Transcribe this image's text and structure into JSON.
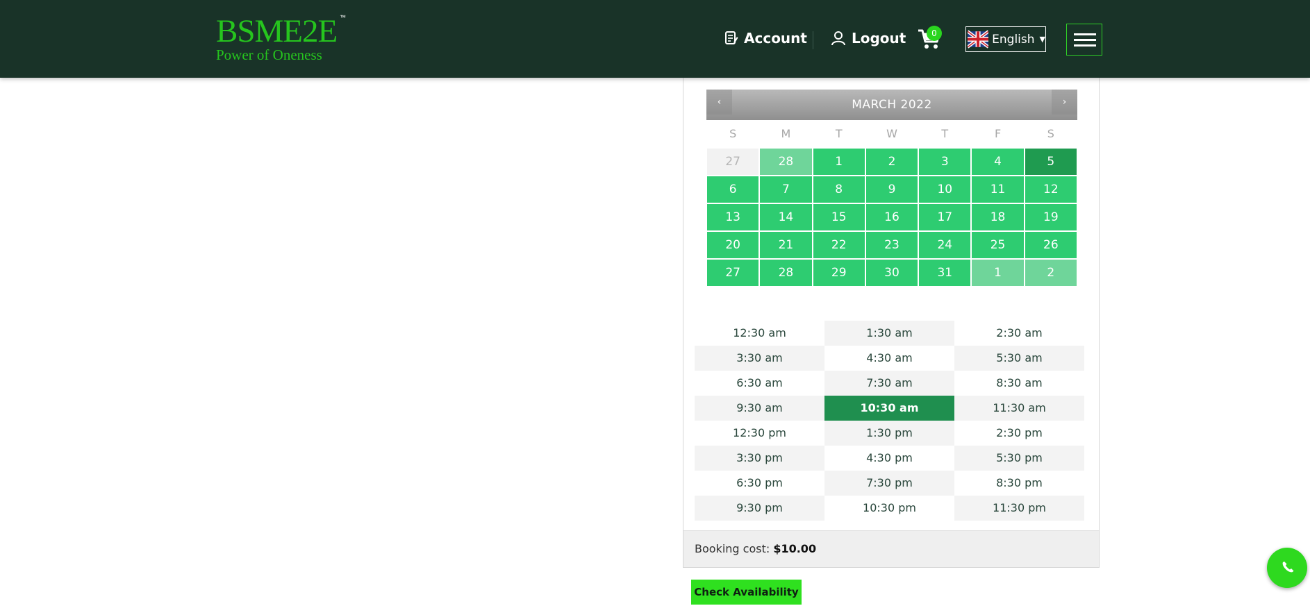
{
  "header": {
    "logo_text": "BSME2E",
    "logo_tm": "™",
    "logo_tagline": "Power of Oneness",
    "account_label": "Account",
    "logout_label": "Logout",
    "cart_count": "0",
    "language": "English",
    "icons": [
      "account-icon",
      "user-icon",
      "cart-icon",
      "uk-flag-icon",
      "menu-icon",
      "phone-icon"
    ]
  },
  "calendar": {
    "title": "MARCH 2022",
    "prev_label": "‹",
    "next_label": "›",
    "weekdays": [
      "S",
      "M",
      "T",
      "W",
      "T",
      "F",
      "S"
    ],
    "weeks": [
      [
        {
          "d": "27",
          "s": "other"
        },
        {
          "d": "28",
          "s": "light"
        },
        {
          "d": "1",
          "s": ""
        },
        {
          "d": "2",
          "s": ""
        },
        {
          "d": "3",
          "s": ""
        },
        {
          "d": "4",
          "s": ""
        },
        {
          "d": "5",
          "s": "today"
        }
      ],
      [
        {
          "d": "6",
          "s": ""
        },
        {
          "d": "7",
          "s": ""
        },
        {
          "d": "8",
          "s": ""
        },
        {
          "d": "9",
          "s": ""
        },
        {
          "d": "10",
          "s": ""
        },
        {
          "d": "11",
          "s": ""
        },
        {
          "d": "12",
          "s": ""
        }
      ],
      [
        {
          "d": "13",
          "s": ""
        },
        {
          "d": "14",
          "s": ""
        },
        {
          "d": "15",
          "s": ""
        },
        {
          "d": "16",
          "s": ""
        },
        {
          "d": "17",
          "s": ""
        },
        {
          "d": "18",
          "s": ""
        },
        {
          "d": "19",
          "s": ""
        }
      ],
      [
        {
          "d": "20",
          "s": ""
        },
        {
          "d": "21",
          "s": ""
        },
        {
          "d": "22",
          "s": ""
        },
        {
          "d": "23",
          "s": ""
        },
        {
          "d": "24",
          "s": ""
        },
        {
          "d": "25",
          "s": ""
        },
        {
          "d": "26",
          "s": ""
        }
      ],
      [
        {
          "d": "27",
          "s": ""
        },
        {
          "d": "28",
          "s": ""
        },
        {
          "d": "29",
          "s": ""
        },
        {
          "d": "30",
          "s": ""
        },
        {
          "d": "31",
          "s": ""
        },
        {
          "d": "1",
          "s": "light"
        },
        {
          "d": "2",
          "s": "light"
        }
      ]
    ]
  },
  "time_slots": [
    "12:30 am",
    "1:30 am",
    "2:30 am",
    "3:30 am",
    "4:30 am",
    "5:30 am",
    "6:30 am",
    "7:30 am",
    "8:30 am",
    "9:30 am",
    "10:30 am",
    "11:30 am",
    "12:30 pm",
    "1:30 pm",
    "2:30 pm",
    "3:30 pm",
    "4:30 pm",
    "5:30 pm",
    "6:30 pm",
    "7:30 pm",
    "8:30 pm",
    "9:30 pm",
    "10:30 pm",
    "11:30 pm"
  ],
  "selected_slot": "10:30 am",
  "booking": {
    "cost_label": "Booking cost:",
    "cost_value": "$10.00",
    "check_button": "Check Availability"
  },
  "colors": {
    "header_bg": "#193328",
    "brand_green": "#26c51e",
    "day_available": "#2ecc71",
    "day_selected": "#1f9b50",
    "slot_selected": "#1f8f4f"
  }
}
